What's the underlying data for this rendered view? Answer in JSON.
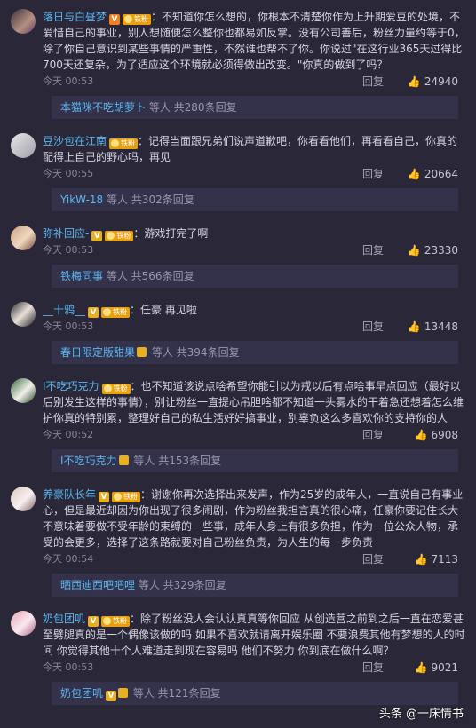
{
  "comments": [
    {
      "user": "落日与白昼梦",
      "text": "不知道你怎么想的，你根本不清楚你作为上升期爱豆的处境，不爱惜自己的事业，别人想随便怎么整你也都易如反掌。没有公司善后，粉丝力量约等于0，除了你自己意识到某些事情的严重性，不然谁也帮不了你。你说过\"在这行业365天过得比700天还复杂，为了适应这个环境就必须得做出改变。\"你真的做到了吗？",
      "time": "今天 00:53",
      "reply": "回复",
      "likes": "24940",
      "replies_user": "本猫咪不吃胡萝卜",
      "replies_text": "等人 共280条回复"
    },
    {
      "user": "豆沙包在江南",
      "text": "记得当面跟兄弟们说声道歉吧，你看看他们，再看看自己，你真的配得上自己的野心吗，再见",
      "time": "今天 00:55",
      "reply": "回复",
      "likes": "20664",
      "replies_user": "YikW-18",
      "replies_text": "等人 共302条回复"
    },
    {
      "user": "弥补回应-",
      "text": "游戏打完了啊",
      "time": "今天 00:53",
      "reply": "回复",
      "likes": "23330",
      "replies_user": "铁梅同事",
      "replies_text": "等人 共566条回复"
    },
    {
      "user": "__十鸦__",
      "text": "任豪 再见啦",
      "time": "今天 00:53",
      "reply": "回复",
      "likes": "13448",
      "replies_user": "春日限定版甜果",
      "replies_text": "等人 共394条回复"
    },
    {
      "user": "I不吃巧克力",
      "text": "也不知道该说点啥希望你能引以为戒以后有点啥事早点回应（最好以后别发生这样的事情），别让粉丝一直提心吊胆啥都不知道一头雾水的干着急还想着怎么维护你真的特别累，整理好自己的私生活好好搞事业，别辜负这么多喜欢你的支持你的人",
      "time": "今天 00:52",
      "reply": "回复",
      "likes": "6908",
      "replies_user": "I不吃巧克力",
      "replies_text": "等人 共153条回复"
    },
    {
      "user": "养豪队长年",
      "text": "谢谢你再次选择出来发声，作为25岁的成年人，一直说自己有事业心，但是最近却因为你出现了很多闹剧，作为粉丝我担言真的很心痛，任豪你要记住长大不意味着要做不受年龄的束缚的一些事，成年人身上有很多负担，作为一位公众人物，承受的会更多，选择了这条路就要对自己粉丝负责，为人生的每一步负责",
      "time": "今天 00:54",
      "reply": "回复",
      "likes": "7113",
      "replies_user": "晒西迪西吧吧哩",
      "replies_text": "等人 共329条回复"
    },
    {
      "user": "奶包团叽",
      "text": "除了粉丝没人会认认真真等你回应 从创造营之前到之后一直在恋爱甚至劈腿真的是一个偶像该做的吗 如果不喜欢就请离开娱乐圈 不要浪费其他有梦想的人的时间 你觉得其他十个人难道走到现在容易吗 他们不努力 你到底在做什么啊？",
      "time": "今天 00:53",
      "reply": "回复",
      "likes": "9021",
      "replies_user": "奶包团叽",
      "replies_text": "等人 共121条回复"
    }
  ],
  "watermark": "头条 @一床情书"
}
